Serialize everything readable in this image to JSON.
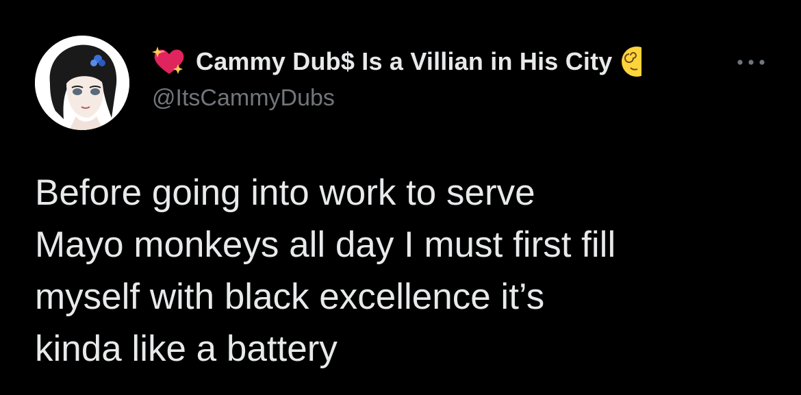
{
  "tweet": {
    "author": {
      "display_name": "Cammy Dub$ Is a Villian in His City",
      "handle": "@ItsCammyDubs",
      "avatar_icon": "anime-avatar-image",
      "name_prefix_icon": "sparkling-heart-icon",
      "name_suffix_icon": "face-with-spiral-eyes-icon"
    },
    "more_icon": "more-options-icon",
    "text_lines": [
      "Before going into work to serve",
      "Mayo monkeys all day I must first fill",
      "myself with black excellence it’s",
      "kinda like a battery"
    ]
  },
  "colors": {
    "background": "#000000",
    "primary_text": "#E7E9EA",
    "secondary_text": "#71767B",
    "heart": "#E0245E",
    "sparkle": "#FFCC4D",
    "emoji_face": "#FFD43B"
  }
}
